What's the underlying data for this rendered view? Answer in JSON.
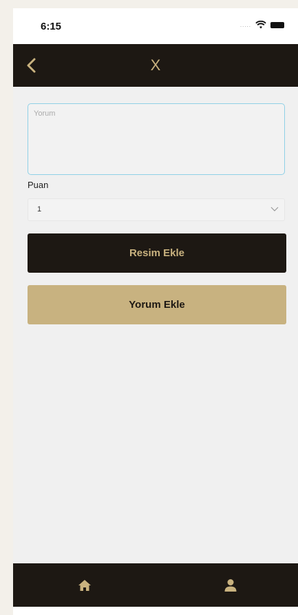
{
  "status_bar": {
    "time": "6:15",
    "signal_dots": ".....",
    "icons": [
      "wifi-icon",
      "battery-icon"
    ]
  },
  "nav_bar": {
    "title": "X",
    "back_icon": "chevron-left-icon",
    "accent_color": "#c9b27f",
    "background_color": "#1d1813"
  },
  "form": {
    "comment_placeholder": "Yorum",
    "comment_value": "",
    "rating_label": "Puan",
    "rating_value": "1",
    "add_image_label": "Resim Ekle",
    "add_comment_label": "Yorum Ekle"
  },
  "tab_bar": {
    "items": [
      {
        "name": "home",
        "icon": "home-icon"
      },
      {
        "name": "profile",
        "icon": "user-icon"
      }
    ],
    "icon_color": "#c9b27f"
  }
}
